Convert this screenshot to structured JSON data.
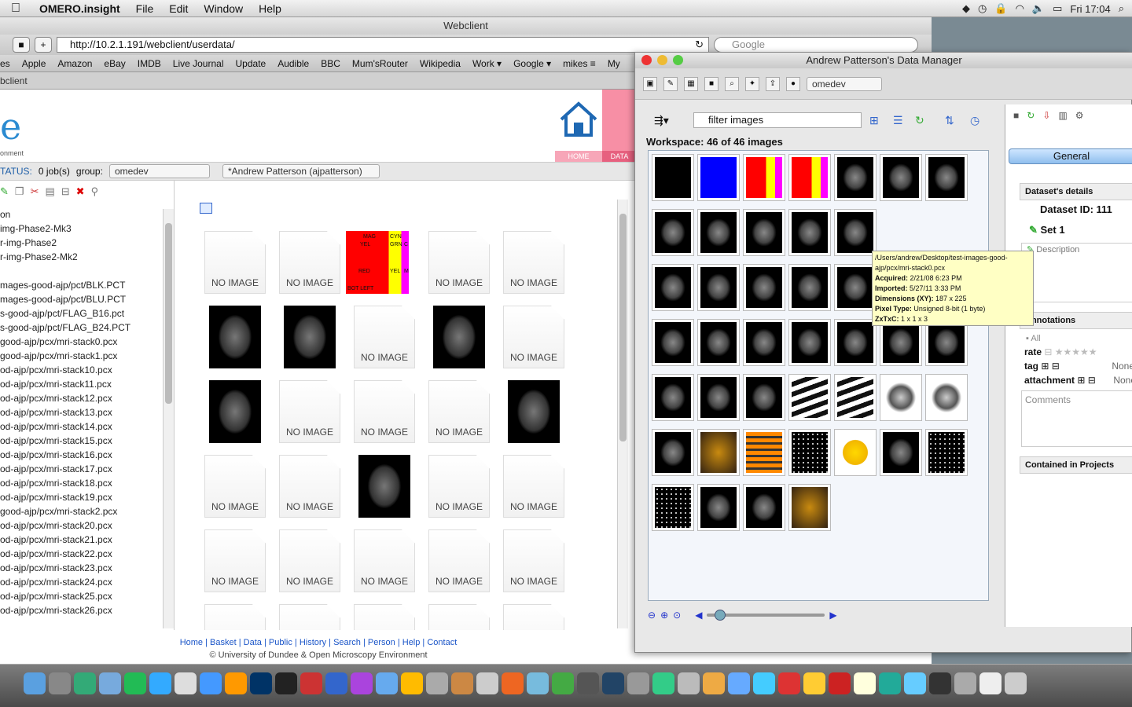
{
  "menubar": {
    "app_name": "OMERO.insight",
    "items": [
      "File",
      "Edit",
      "Window",
      "Help"
    ],
    "clock": "Fri 17:04"
  },
  "browser": {
    "window_title": "Webclient",
    "url": "http://10.2.1.191/webclient/userdata/",
    "search_placeholder": "Google",
    "bookmarks": [
      "es",
      "Apple",
      "Amazon",
      "eBay",
      "IMDB",
      "Live Journal",
      "Update",
      "Audible",
      "BBC",
      "Mum'sRouter",
      "Wikipedia",
      "Work ▾",
      "Google ▾",
      "mikes ≡",
      "My"
    ],
    "tab_label": "bclient"
  },
  "page": {
    "logo_sub": "onment",
    "home_label": "HOME",
    "data_label": "DATA",
    "status_label": "TATUS:",
    "jobs": "0 job(s)",
    "group_label": "group:",
    "group_value": "omedev",
    "user_value": "*Andrew Patterson (ajpatterson)",
    "tree": [
      "on",
      "img-Phase2-Mk3",
      "r-img-Phase2",
      "r-img-Phase2-Mk2",
      "",
      "mages-good-ajp/pct/BLK.PCT",
      "mages-good-ajp/pct/BLU.PCT",
      "s-good-ajp/pct/FLAG_B16.pct",
      "s-good-ajp/pct/FLAG_B24.PCT",
      "good-ajp/pcx/mri-stack0.pcx",
      "good-ajp/pcx/mri-stack1.pcx",
      "od-ajp/pcx/mri-stack10.pcx",
      "od-ajp/pcx/mri-stack11.pcx",
      "od-ajp/pcx/mri-stack12.pcx",
      "od-ajp/pcx/mri-stack13.pcx",
      "od-ajp/pcx/mri-stack14.pcx",
      "od-ajp/pcx/mri-stack15.pcx",
      "od-ajp/pcx/mri-stack16.pcx",
      "od-ajp/pcx/mri-stack17.pcx",
      "od-ajp/pcx/mri-stack18.pcx",
      "od-ajp/pcx/mri-stack19.pcx",
      "good-ajp/pcx/mri-stack2.pcx",
      "od-ajp/pcx/mri-stack20.pcx",
      "od-ajp/pcx/mri-stack21.pcx",
      "od-ajp/pcx/mri-stack22.pcx",
      "od-ajp/pcx/mri-stack23.pcx",
      "od-ajp/pcx/mri-stack24.pcx",
      "od-ajp/pcx/mri-stack25.pcx",
      "od-ajp/pcx/mri-stack26.pcx"
    ],
    "no_image_text": "NO IMAGE",
    "flag_labels": [
      "MAG",
      "CYN",
      "YEL",
      "GRN",
      "C",
      "RED",
      "YEL",
      "M",
      "BOT LEFT"
    ],
    "footer_links": [
      "Home",
      "Basket",
      "Data",
      "Public",
      "History",
      "Search",
      "Person",
      "Help",
      "Contact"
    ],
    "footer_copy": "© University of Dundee & Open Microscopy Environment"
  },
  "data_manager": {
    "title": "Andrew Patterson's Data Manager",
    "group": "omedev",
    "filter_text": "filter  images",
    "workspace": "Workspace: 46 of 46 images",
    "tooltip": {
      "path": "/Users/andrew/Desktop/test-images-good-ajp/pcx/mri-stack0.pcx",
      "acquired_label": "Acquired:",
      "acquired": "2/21/08 6:23 PM",
      "imported_label": "Imported:",
      "imported": "5/27/11 3:33 PM",
      "dims_label": "Dimensions (XY):",
      "dims": "187 x 225",
      "ptype_label": "Pixel Type:",
      "ptype": "Unsigned 8-bit (1 byte)",
      "zxtxc_label": "ZxTxC:",
      "zxtxc": "1 x 1 x 3"
    },
    "side": {
      "tab": "General",
      "details_header": "Dataset's details",
      "dataset_id": "Dataset ID: 111",
      "name": "Set 1",
      "description": "Description",
      "annotations_header": "Annotations",
      "all": "All",
      "rate": "rate",
      "tag": "tag",
      "tag_value": "None",
      "attachment": "attachment",
      "attachment_value": "None",
      "comments": "Comments",
      "projects_header": "Contained in Projects"
    }
  }
}
